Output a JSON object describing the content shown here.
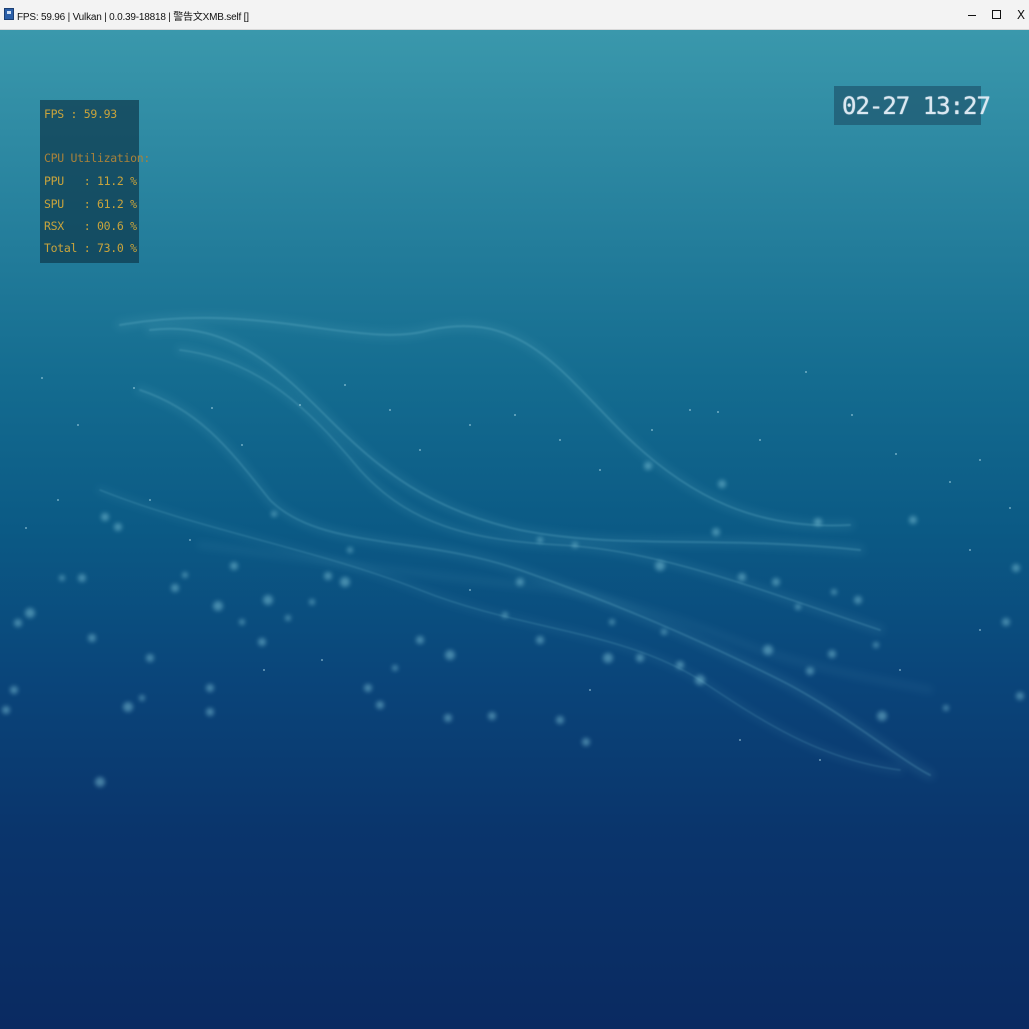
{
  "window": {
    "title": "FPS: 59.96 | Vulkan | 0.0.39-18818 | 警告文XMB.self []",
    "minimize_label": "–",
    "maximize_label": "",
    "close_label": "X"
  },
  "perf_overlay": {
    "fps": "FPS : 59.93",
    "cpu_header": "CPU Utilization:",
    "ppu": "PPU   : 11.2 %",
    "spu": "SPU   : 61.2 %",
    "rsx": "RSX   : 00.6 %",
    "total": "Total : 73.0 %"
  },
  "clock": {
    "datetime": "02-27 13:27"
  },
  "colors": {
    "overlay_text": "#c9a43c",
    "clock_text": "#dbe8f2",
    "background_top": "#3a98ac",
    "background_bottom": "#0a2a61"
  },
  "icons": {
    "app": "rpcs3-app-icon"
  }
}
